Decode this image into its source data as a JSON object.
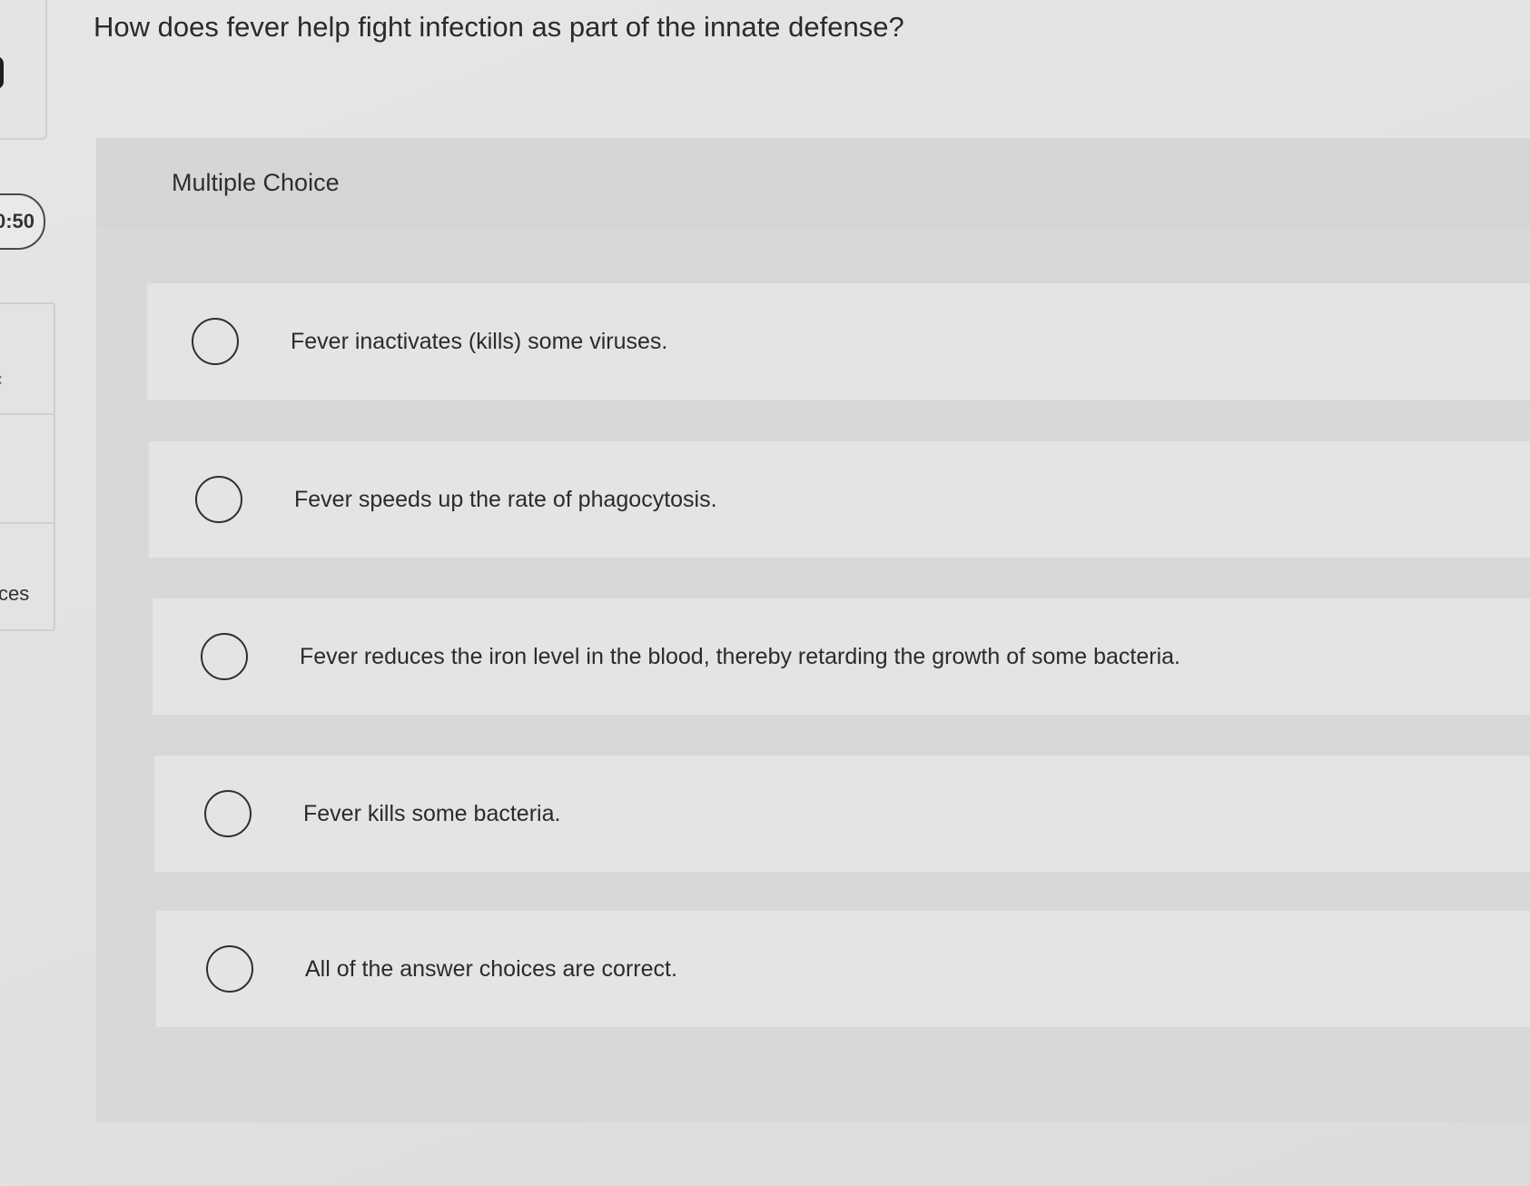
{
  "question": {
    "text": "How does fever help fight infection as part of the innate defense?"
  },
  "sidebar": {
    "timer": "0:50",
    "arrow_icon": "chevron-left-icon",
    "partial_label": "ces"
  },
  "card": {
    "type_label": "Multiple Choice"
  },
  "options": [
    {
      "label": "Fever inactivates (kills) some viruses.",
      "selected": false
    },
    {
      "label": "Fever speeds up the rate of phagocytosis.",
      "selected": false
    },
    {
      "label": "Fever reduces the iron level in the blood, thereby retarding the growth of some bacteria.",
      "selected": false
    },
    {
      "label": "Fever kills some bacteria.",
      "selected": false
    },
    {
      "label": "All of the answer choices are correct.",
      "selected": false
    }
  ]
}
